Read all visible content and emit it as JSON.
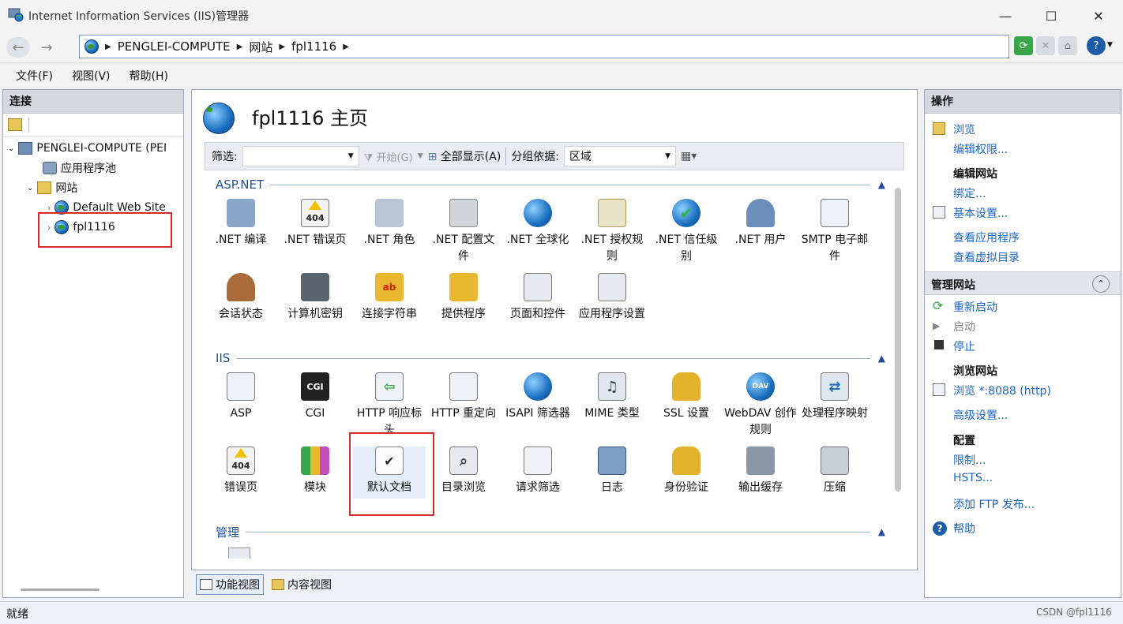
{
  "window": {
    "title": "Internet Information Services (IIS)管理器",
    "min": "—",
    "max": "☐",
    "close": "✕"
  },
  "address": {
    "crumbs": [
      "PENGLEI-COMPUTE",
      "网站",
      "fpl1116"
    ]
  },
  "menu": [
    "文件(F)",
    "视图(V)",
    "帮助(H)"
  ],
  "left": {
    "header": "连接",
    "tree": [
      {
        "label": "PENGLEI-COMPUTE (PEI"
      },
      {
        "label": "应用程序池"
      },
      {
        "label": "网站"
      },
      {
        "label": "Default Web Site"
      },
      {
        "label": "fpl1116"
      }
    ]
  },
  "center": {
    "title": "fpl1116 主页",
    "filter": {
      "label": "筛选:",
      "start": "开始(G)",
      "show_all": "全部显示(A)",
      "group_label": "分组依据:",
      "group_value": "区域"
    },
    "sections": {
      "aspnet": "ASP.NET",
      "iis": "IIS",
      "manage": "管理"
    },
    "aspnet_features": [
      ".NET 编译",
      ".NET 错误页",
      ".NET 角色",
      ".NET 配置文件",
      ".NET 全球化",
      ".NET 授权规则",
      ".NET 信任级别",
      ".NET 用户",
      "SMTP 电子邮件",
      "会话状态",
      "计算机密钥",
      "连接字符串",
      "提供程序",
      "页面和控件",
      "应用程序设置"
    ],
    "iis_features": [
      "ASP",
      "CGI",
      "HTTP 响应标头",
      "HTTP 重定向",
      "ISAPI 筛选器",
      "MIME 类型",
      "SSL 设置",
      "WebDAV 创作规则",
      "处理程序映射",
      "错误页",
      "模块",
      "默认文档",
      "目录浏览",
      "请求筛选",
      "日志",
      "身份验证",
      "输出缓存",
      "压缩"
    ],
    "icon_text": {
      "cgi": "CGI",
      "err": "404"
    }
  },
  "view_tabs": [
    "功能视图",
    "内容视图"
  ],
  "right": {
    "header": "操作",
    "items": {
      "browse": "浏览",
      "edit_perm": "编辑权限...",
      "edit_site_head": "编辑网站",
      "bindings": "绑定...",
      "basic": "基本设置...",
      "view_apps": "查看应用程序",
      "view_vdirs": "查看虚拟目录",
      "manage_head": "管理网站",
      "restart": "重新启动",
      "start": "启动",
      "stop": "停止",
      "browse_head": "浏览网站",
      "browse_port": "浏览 *:8088 (http)",
      "advanced": "高级设置...",
      "config_head": "配置",
      "limits": "限制...",
      "hsts": "HSTS...",
      "ftp": "添加 FTP 发布...",
      "help": "帮助"
    }
  },
  "status": {
    "text": "就绪",
    "watermark": "CSDN @fpl1116"
  },
  "colors": {
    "link": "#1c66c9",
    "section": "#1f4f9a",
    "highlight_box": "#d42b2b"
  }
}
